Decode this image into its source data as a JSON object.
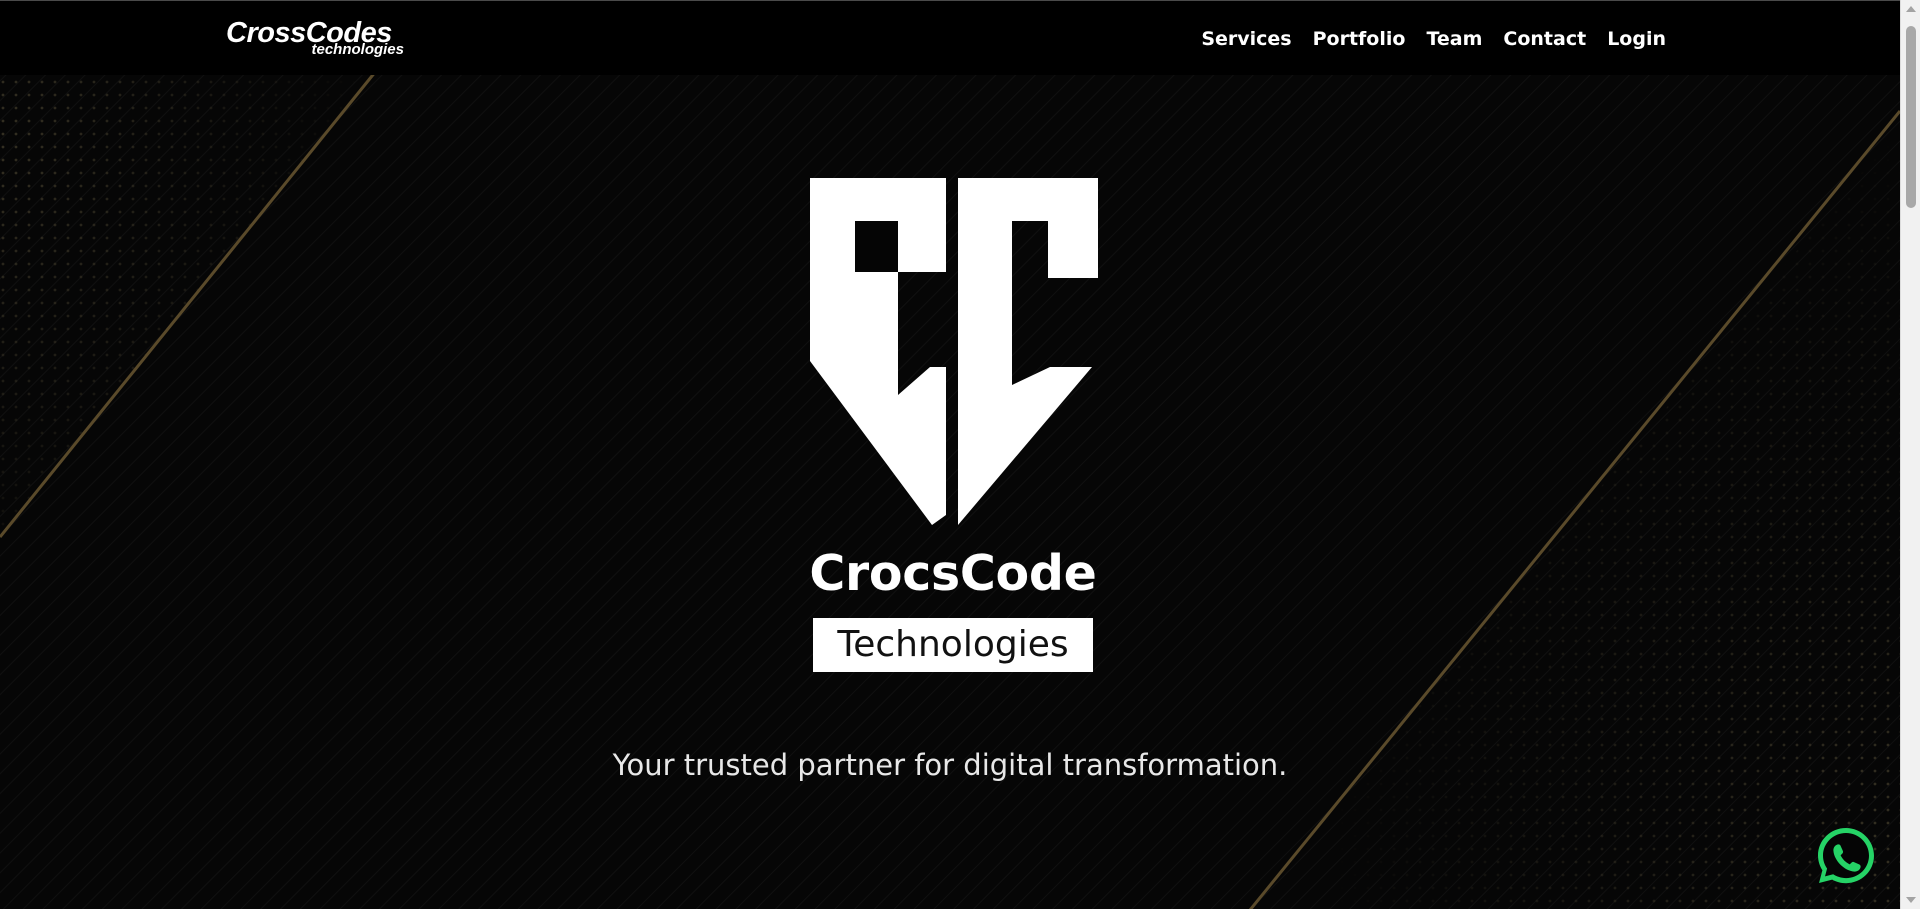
{
  "brand": {
    "name": "CrossCodes",
    "sub": "technologies"
  },
  "nav": {
    "items": [
      "Services",
      "Portfolio",
      "Team",
      "Contact",
      "Login"
    ]
  },
  "hero": {
    "logo_name": "CrocsCode",
    "logo_tag": "Technologies",
    "tagline": "Your trusted partner for digital transformation."
  },
  "icons": {
    "whatsapp": "whatsapp-icon",
    "logo": "cc-shield-logo"
  },
  "colors": {
    "background": "#050505",
    "accent_lines": "#5a4a2a",
    "text": "#ffffff",
    "whatsapp": "#25d366"
  }
}
